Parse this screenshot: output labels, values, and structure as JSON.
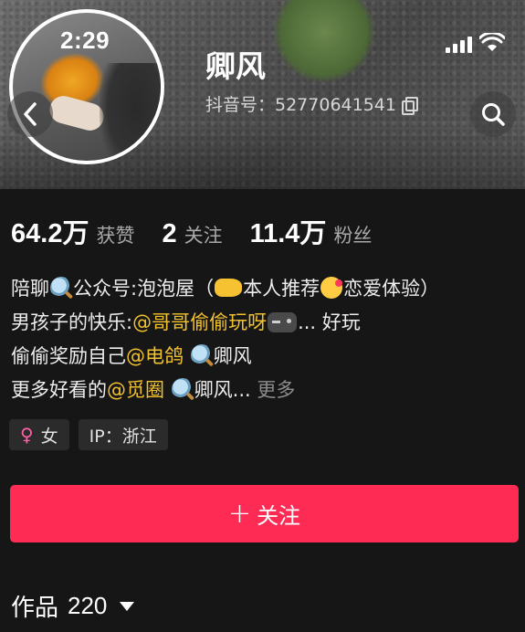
{
  "status_bar": {
    "time": "2:29"
  },
  "profile": {
    "name": "卿风",
    "douyin_id": "抖音号：52770641541"
  },
  "stats": [
    {
      "value": "64.2万",
      "label": "获赞"
    },
    {
      "value": "2",
      "label": "关注"
    },
    {
      "value": "11.4万",
      "label": "粉丝"
    }
  ],
  "bio": {
    "line1": {
      "a": "陪聊",
      "b": "公众号:泡泡屋（",
      "c": "本人推荐",
      "d": "恋爱体验）"
    },
    "line2": {
      "a": "男孩子的快乐:",
      "mention": "@哥哥偷偷玩呀",
      "b": "... 好玩"
    },
    "line3": {
      "a": "偷偷奖励自己",
      "mention": "@电鸽",
      "b": "卿风"
    },
    "line4": {
      "a": "更多好看的",
      "mention": "@觅圈",
      "b": "卿风...",
      "more": "更多"
    }
  },
  "tags": {
    "gender": "女",
    "ip": "IP：浙江"
  },
  "follow_button": {
    "label": "关注"
  },
  "works": {
    "label": "作品",
    "count": "220"
  },
  "colors": {
    "accent": "#fe2c55",
    "mention": "#f2c12e",
    "background": "#161616"
  },
  "icons": [
    "back-icon",
    "search-icon",
    "signal-icon",
    "wifi-icon",
    "copy-icon",
    "female-icon",
    "plus-icon",
    "caret-down-icon"
  ]
}
